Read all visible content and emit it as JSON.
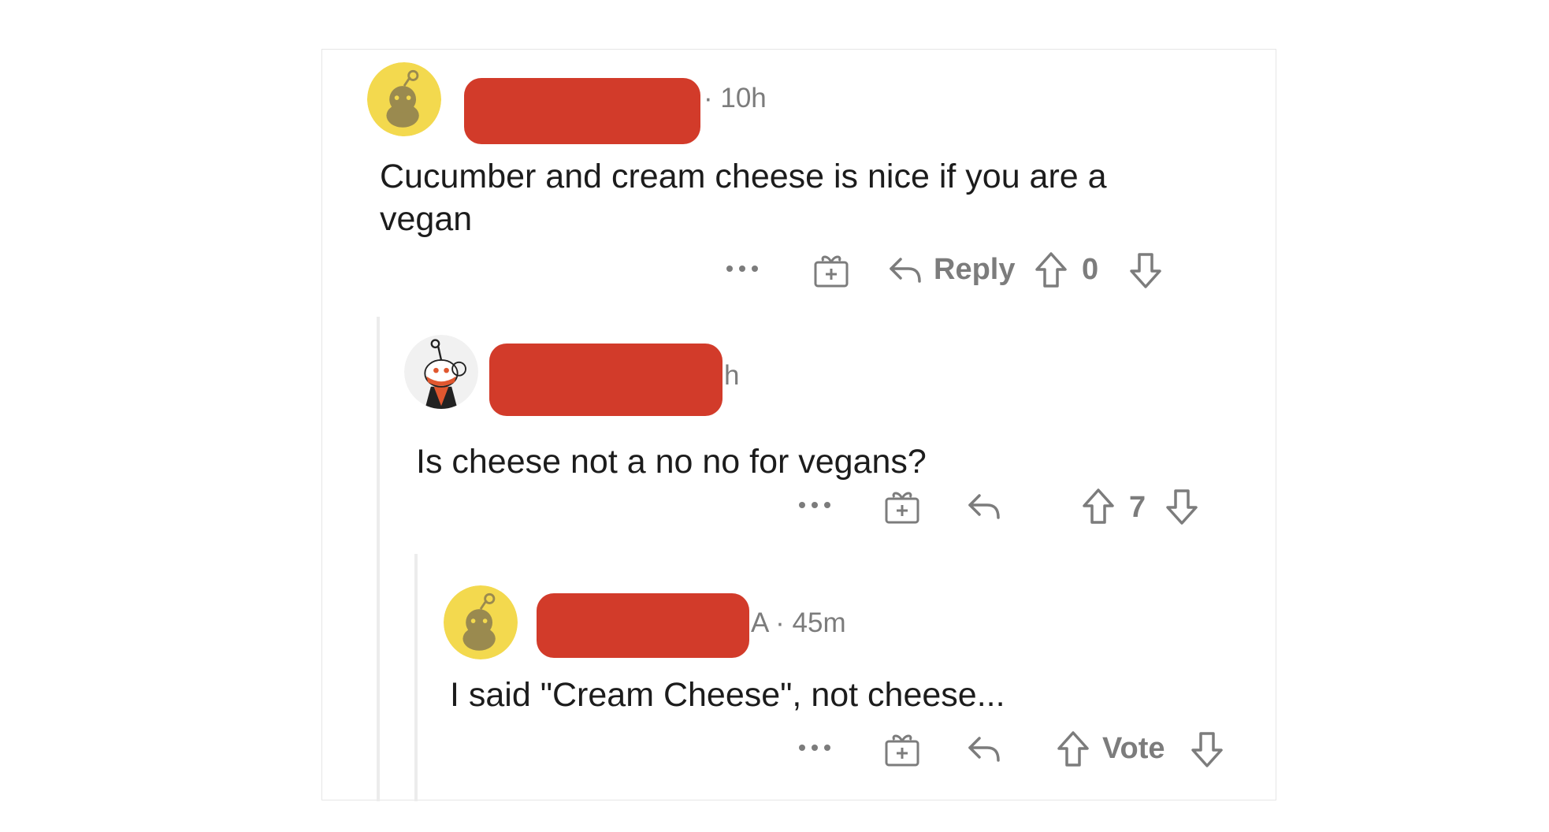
{
  "comments": [
    {
      "time": "· 10h",
      "text": "Cucumber and cream cheese is nice if you are a\nvegan",
      "actions": {
        "more_label": "···",
        "reply_label": "Reply",
        "vote_count": "0"
      }
    },
    {
      "time": "h",
      "text": "Is cheese not a no no for vegans?",
      "actions": {
        "more_label": "···",
        "vote_count": "7"
      }
    },
    {
      "time": "A · 45m",
      "text": "I said \"Cream Cheese\", not cheese...",
      "actions": {
        "more_label": "···",
        "vote_label": "Vote"
      }
    }
  ],
  "icons": {
    "more": "more-options-icon",
    "award": "award-gift-icon",
    "reply": "reply-arrow-icon",
    "upvote": "upvote-arrow-icon",
    "downvote": "downvote-arrow-icon",
    "avatar": "snoo-avatar-icon"
  },
  "colors": {
    "redaction": "#d23b2a",
    "avatar_yellow": "#f3d94e",
    "muted_text": "#7c7c7c"
  }
}
